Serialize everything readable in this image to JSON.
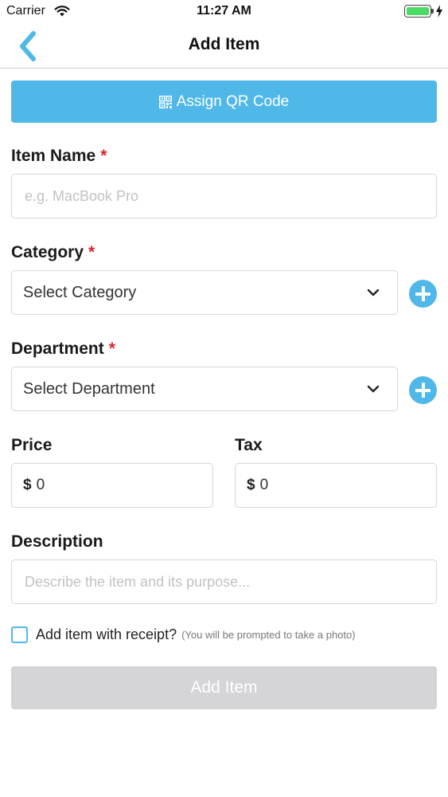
{
  "status": {
    "carrier": "Carrier",
    "time": "11:27 AM",
    "battery_level": 1.0
  },
  "nav": {
    "title": "Add Item",
    "back_icon": "chevron-left-icon"
  },
  "qr_button": {
    "label": "Assign QR Code",
    "icon": "qr-code-icon"
  },
  "form": {
    "item_name": {
      "label": "Item Name",
      "required_mark": "*",
      "placeholder": "e.g. MacBook Pro",
      "value": ""
    },
    "category": {
      "label": "Category",
      "required_mark": "*",
      "selected": "Select Category"
    },
    "department": {
      "label": "Department",
      "required_mark": "*",
      "selected": "Select Department"
    },
    "price": {
      "label": "Price",
      "currency": "$",
      "value": "0"
    },
    "tax": {
      "label": "Tax",
      "currency": "$",
      "value": "0"
    },
    "description": {
      "label": "Description",
      "placeholder": "Describe the item and its purpose...",
      "value": ""
    },
    "receipt": {
      "label": "Add item with receipt?",
      "hint": "(You will be prompted to take a photo)",
      "checked": false
    }
  },
  "submit": {
    "label": "Add Item"
  },
  "colors": {
    "accent": "#4fb8e8",
    "required": "#d9262c",
    "disabled_button": "#d5d4d7",
    "battery": "#4cd964"
  }
}
